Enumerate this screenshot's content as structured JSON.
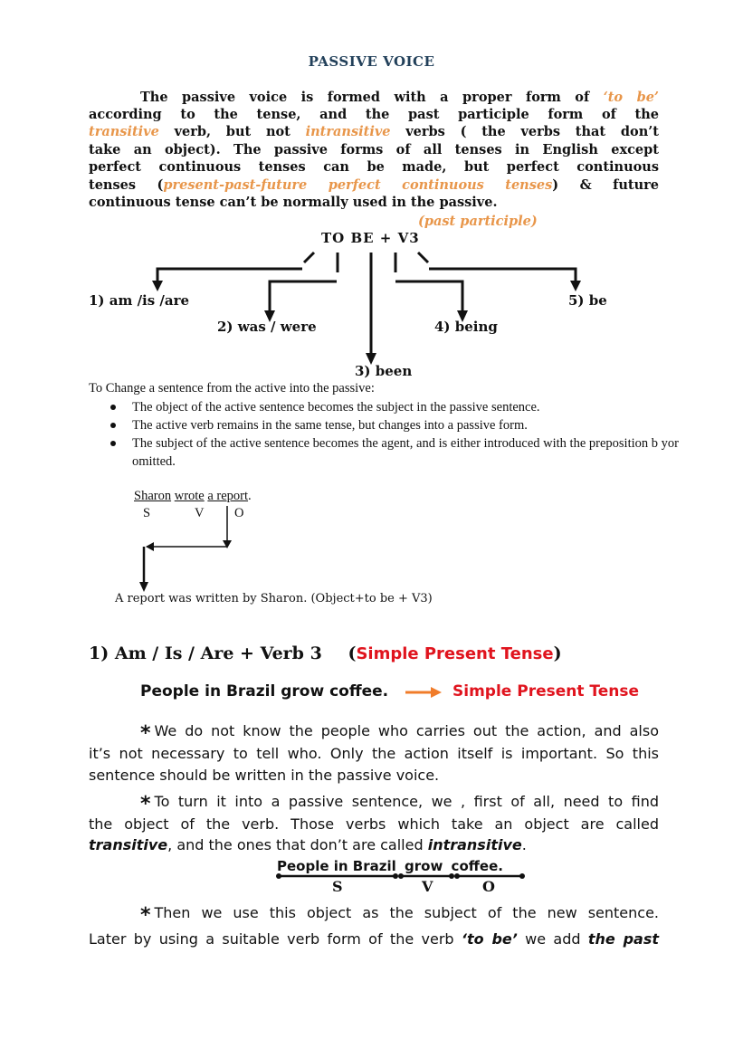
{
  "title": "PASSIVE  VOICE",
  "intro": {
    "lines": [
      [
        {
          "t": "The passive voice is formed with a proper form of "
        },
        {
          "t": "‘to be’",
          "c": "orange"
        }
      ],
      [
        {
          "t": "according to the tense, and the past participle form of the"
        }
      ],
      [
        {
          "t": "transitive",
          "c": "orange"
        },
        {
          "t": " verb, but not "
        },
        {
          "t": "intransitive",
          "c": "orange"
        },
        {
          "t": " verbs ( the verbs that don’t"
        }
      ],
      [
        {
          "t": "take an object). The passive forms of all tenses in English except"
        }
      ],
      [
        {
          "t": "perfect continuous tenses can be made, but perfect continuous"
        }
      ],
      [
        {
          "t": "tenses ("
        },
        {
          "t": "present-past-future perfect continuous tenses",
          "c": "orange"
        },
        {
          "t": ") & future"
        }
      ],
      [
        {
          "t": "continuous tense can’t be normally used in the passive."
        }
      ]
    ],
    "past_participle_note": "(past participle)"
  },
  "formula": "TO BE + V3",
  "forms": {
    "f1": "1) am /is /are",
    "f2": "2) was / were",
    "f3": "3) been",
    "f4": "4) being",
    "f5": "5) be"
  },
  "change": {
    "title": "To Change a sentence from the active into the passive:",
    "bullets": [
      "The object of the active sentence becomes the subject in the passive sentence.",
      "The active verb remains in the same tense, but changes into a passive form.",
      "The subject of the active sentence becomes the agent, and is either introduced with the preposition b yor omitted."
    ]
  },
  "example1": {
    "subject": "Sharon",
    "verb": "wrote",
    "object": "a report",
    "period": ".",
    "s": "S",
    "v": "V",
    "o": "O",
    "result": "A report was written by Sharon. (Object+to be + V3)"
  },
  "section1": {
    "heading": "1) Am / Is / Are + Verb 3",
    "tense_open": "(",
    "tense": "Simple  Present Tense",
    "tense_close": ")",
    "example": "People  in Brazil  grow  coffee.",
    "arrow_color": "#f07c2a",
    "example_tense": "Simple Present Tense",
    "para1": [
      "We do not know the people who carries out the action, and also",
      "it’s not necessary to tell who. Only the action itself is important. So this",
      "sentence should be written in the passive voice."
    ],
    "para2": [
      "To turn it into a passive sentence, we , first of all, need to find",
      "the object of the verb. Those verbs which take an object are called"
    ],
    "para2_last": {
      "transitive": "transitive",
      "mid": ", and the ones that don’t are called ",
      "intransitive": "intransitive",
      "end": "."
    },
    "svo": {
      "subject": "People  in Brazil",
      "verb": "grow",
      "object": "coffee",
      "period": ".",
      "s": "S",
      "v": "V",
      "o": "O"
    },
    "para3_line1": "Then we use this object as the subject of the new sentence.",
    "para3_line2": {
      "pre": "Later by using a suitable verb form of the verb ",
      "tobe": "‘to be’",
      "mid": " we add ",
      "past": "the past"
    }
  },
  "colors": {
    "title": "#22405a",
    "orange": "#e8964a",
    "red": "#e0141e",
    "arrow": "#f07c2a"
  }
}
